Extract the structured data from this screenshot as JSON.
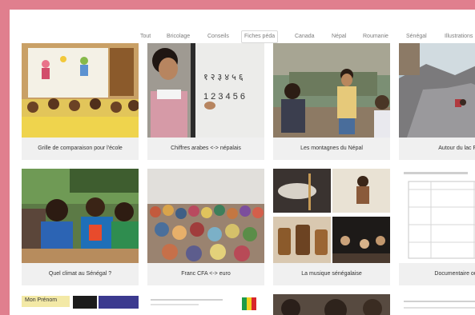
{
  "nav": {
    "items": [
      "Tout",
      "Bricolage",
      "Conseils",
      "Fiches péda",
      "Canada",
      "Népal",
      "Roumanie",
      "Sénégal",
      "Illustrations"
    ],
    "active_index": 3
  },
  "cards": [
    {
      "caption": "Grille de comparaison pour l'école"
    },
    {
      "caption": "Chiffres arabes <-> népalais"
    },
    {
      "caption": "Les montagnes du Népal"
    },
    {
      "caption": "Autour du lac F"
    },
    {
      "caption": "Quel climat au Sénégal ?"
    },
    {
      "caption": "Franc CFA <-> euro"
    },
    {
      "caption": "La musique sénégalaise"
    },
    {
      "caption": "Documentaire ou f"
    }
  ],
  "bottom_row": {
    "poster_title": "Mon Prénom"
  },
  "colors": {
    "border": "#e07f8e",
    "background": "#ffffff",
    "caption_bg": "#f0f0f0"
  }
}
